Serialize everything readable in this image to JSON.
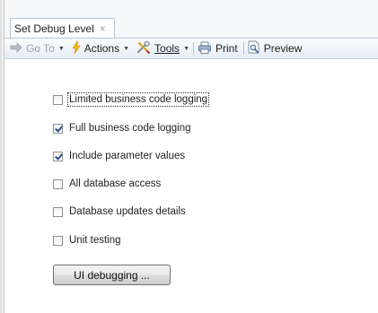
{
  "tab": {
    "title": "Set Debug Level",
    "close_glyph": "×"
  },
  "toolbar": {
    "goto": "Go To",
    "actions": "Actions",
    "tools": "Tools",
    "print": "Print",
    "preview": "Preview"
  },
  "options": [
    {
      "label": "Limited business code logging",
      "checked": false,
      "focused": true
    },
    {
      "label": "Full business code logging",
      "checked": true,
      "focused": false
    },
    {
      "label": "Include parameter values",
      "checked": true,
      "focused": false
    },
    {
      "label": "All database access",
      "checked": false,
      "focused": false
    },
    {
      "label": "Database updates details",
      "checked": false,
      "focused": false
    },
    {
      "label": "Unit testing",
      "checked": false,
      "focused": false
    }
  ],
  "button": {
    "ui_debugging": "UI debugging ..."
  },
  "colors": {
    "accent_border": "#b9c6d6",
    "check_mark": "#2a4f8a"
  }
}
